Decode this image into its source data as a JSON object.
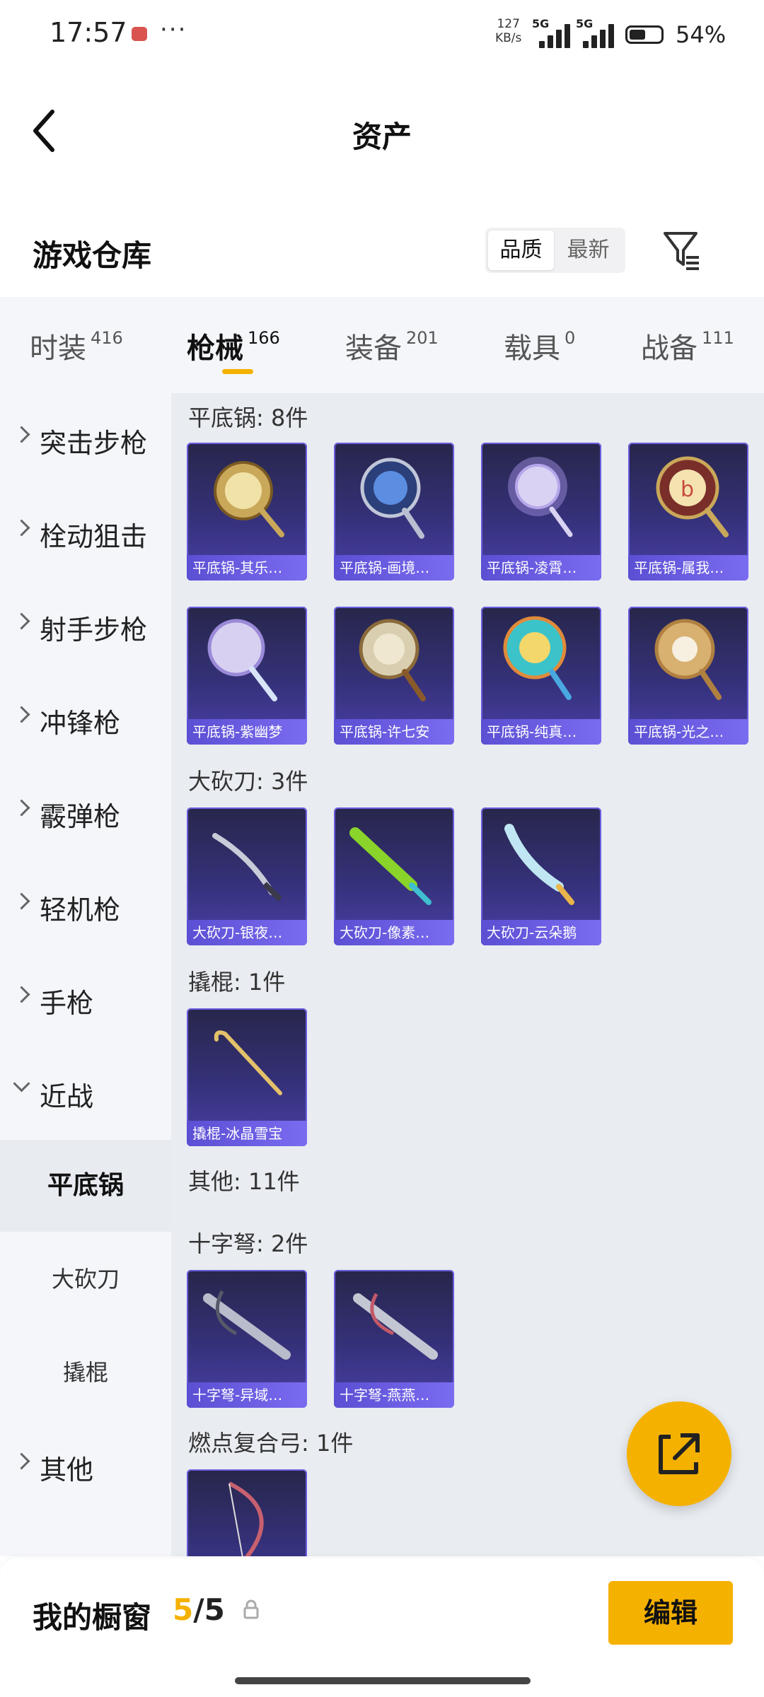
{
  "status_bar": {
    "time": "17:57",
    "speed_value": "127",
    "speed_unit": "KB/s",
    "network1": "5G",
    "network2": "5G",
    "battery": "54%"
  },
  "header": {
    "title": "资产"
  },
  "warehouse": {
    "title": "游戏仓库",
    "sort_quality": "品质",
    "sort_newest": "最新"
  },
  "tabs": [
    {
      "label": "时装",
      "count": "416"
    },
    {
      "label": "枪械",
      "count": "166"
    },
    {
      "label": "装备",
      "count": "201"
    },
    {
      "label": "载具",
      "count": "0"
    },
    {
      "label": "战备",
      "count": "111"
    }
  ],
  "sidebar": {
    "categories": [
      "突击步枪",
      "栓动狙击",
      "射手步枪",
      "冲锋枪",
      "霰弹枪",
      "轻机枪",
      "手枪",
      "近战"
    ],
    "sub_items": [
      "平底锅",
      "大砍刀",
      "撬棍"
    ],
    "other": "其他"
  },
  "sections": {
    "pan": {
      "title": "平底锅: 8件",
      "items": [
        "平底锅-其乐…",
        "平底锅-画境…",
        "平底锅-凌霄…",
        "平底锅-属我…",
        "平底锅-紫幽梦",
        "平底锅-许七安",
        "平底锅-纯真…",
        "平底锅-光之…"
      ]
    },
    "machete": {
      "title": "大砍刀: 3件",
      "items": [
        "大砍刀-银夜…",
        "大砍刀-像素…",
        "大砍刀-云朵鹅"
      ]
    },
    "crowbar": {
      "title": "撬棍: 1件",
      "items": [
        "撬棍-冰晶雪宝"
      ]
    },
    "other": {
      "title": "其他: 11件"
    },
    "crossbow": {
      "title": "十字弩: 2件",
      "items": [
        "十字弩-异域…",
        "十字弩-燕燕…"
      ]
    },
    "bow": {
      "title": "燃点复合弓: 1件"
    }
  },
  "bottom_bar": {
    "label": "我的橱窗",
    "used": "5",
    "total": "/5",
    "edit": "编辑"
  },
  "colors": {
    "accent": "#f5b100",
    "card_caption": "#6a5ee0"
  }
}
